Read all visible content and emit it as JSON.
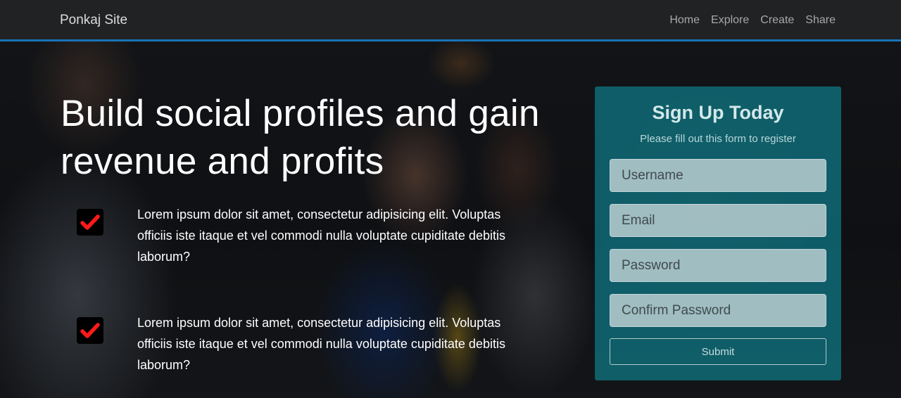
{
  "navbar": {
    "brand": "Ponkaj Site",
    "links": [
      "Home",
      "Explore",
      "Create",
      "Share"
    ]
  },
  "hero": {
    "title": "Build social profiles and gain revenue and profits",
    "features": [
      {
        "icon": "checkmark-icon",
        "text": "Lorem ipsum dolor sit amet, consectetur adipisicing elit. Voluptas officiis iste itaque et vel commodi nulla voluptate cupiditate debitis laborum?"
      },
      {
        "icon": "checkmark-icon",
        "text": "Lorem ipsum dolor sit amet, consectetur adipisicing elit. Voluptas officiis iste itaque et vel commodi nulla voluptate cupiditate debitis laborum?"
      }
    ]
  },
  "signup": {
    "title": "Sign Up Today",
    "subtitle": "Please fill out this form to register",
    "fields": {
      "username_placeholder": "Username",
      "email_placeholder": "Email",
      "password_placeholder": "Password",
      "confirm_placeholder": "Confirm Password"
    },
    "submit_label": "Submit"
  },
  "colors": {
    "navbar_bg": "#202224",
    "navbar_border": "#1a73b6",
    "card_bg": "#0e7d8c",
    "check_color": "#ff1a1a"
  }
}
